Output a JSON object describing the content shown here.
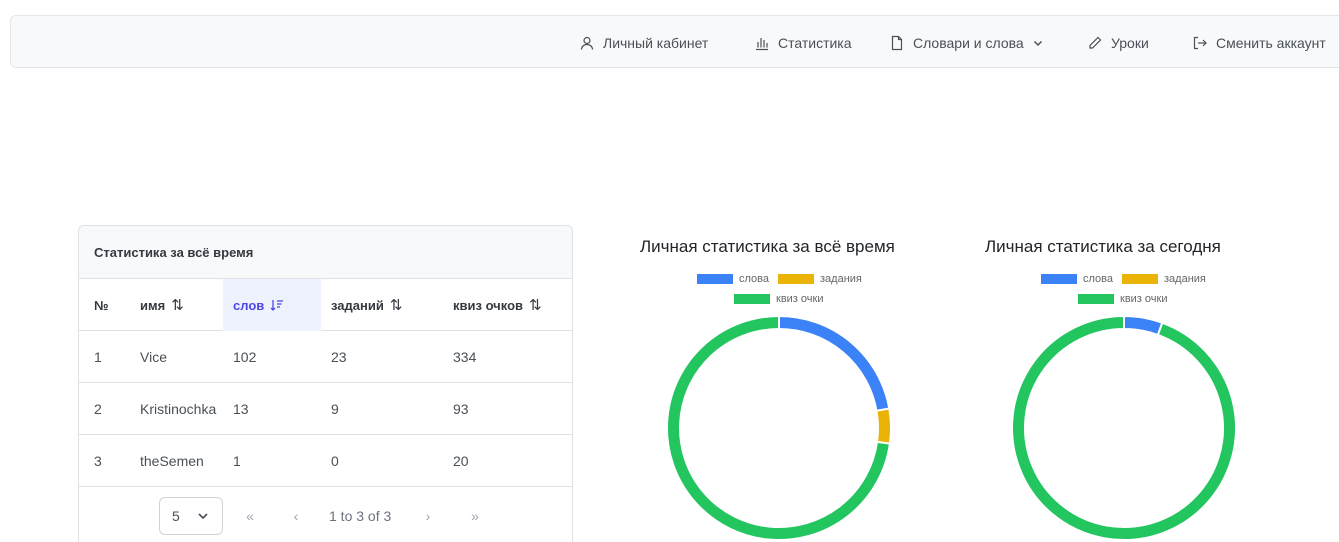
{
  "nav": {
    "profile": "Личный кабинет",
    "stats": "Статистика",
    "dictionaries": "Словари и слова",
    "lessons": "Уроки",
    "logout": "Сменить аккаунт"
  },
  "table": {
    "title": "Статистика за всё время",
    "columns": [
      "№",
      "имя",
      "слов",
      "заданий",
      "квиз очков"
    ],
    "sorted_column": "слов",
    "rows": [
      {
        "no": "1",
        "name": "Vice",
        "words": "102",
        "tasks": "23",
        "quiz": "334"
      },
      {
        "no": "2",
        "name": "Kristinochka",
        "words": "13",
        "tasks": "9",
        "quiz": "93"
      },
      {
        "no": "3",
        "name": "theSemen",
        "words": "1",
        "tasks": "0",
        "quiz": "20"
      }
    ],
    "rows_per_page": "5",
    "page_info": "1 to 3 of 3"
  },
  "colors": {
    "words": "#3b82f6",
    "tasks": "#eab308",
    "quiz": "#22c55e",
    "accent": "#4f46e5"
  },
  "chart_data": [
    {
      "type": "pie",
      "title": "Личная статистика за всё время",
      "labels": [
        "слова",
        "задания",
        "квиз очки"
      ],
      "values": [
        102,
        23,
        334
      ],
      "legend": "top"
    },
    {
      "type": "pie",
      "title": "Личная статистика за сегодня",
      "labels": [
        "слова",
        "задания",
        "квиз очки"
      ],
      "values": [
        2,
        0,
        34
      ],
      "legend": "top"
    }
  ]
}
